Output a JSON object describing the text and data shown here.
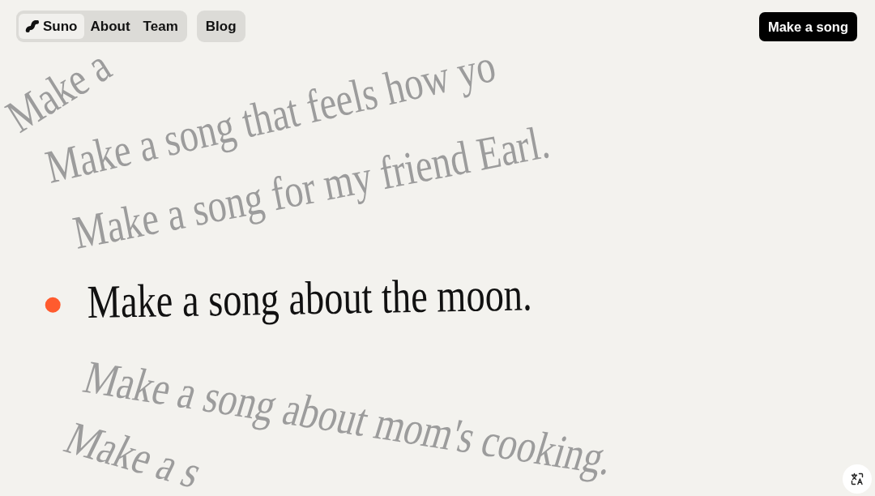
{
  "nav": {
    "groups": [
      {
        "items": [
          {
            "kind": "brand",
            "label": "Suno",
            "selected": true
          },
          {
            "kind": "link",
            "label": "About",
            "selected": false
          },
          {
            "kind": "link",
            "label": "Team",
            "selected": false
          }
        ]
      },
      {
        "items": [
          {
            "kind": "link",
            "label": "Blog",
            "selected": false
          }
        ]
      }
    ]
  },
  "cta_button": {
    "label": "Make a song"
  },
  "prompts": [
    {
      "text": "Make a",
      "selected": false
    },
    {
      "text": "Make a song that feels how yo",
      "selected": false
    },
    {
      "text": "Make a song for my friend Earl.",
      "selected": false
    },
    {
      "text": "Make a song about the moon.",
      "selected": true
    },
    {
      "text": "Make a song about mom's cooking.",
      "selected": false
    },
    {
      "text": "Make a s",
      "selected": false
    }
  ]
}
